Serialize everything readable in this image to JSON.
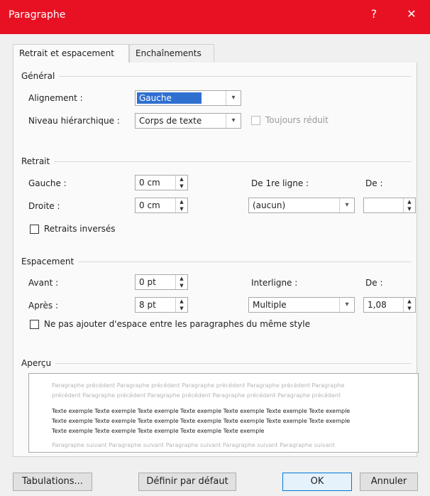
{
  "window": {
    "title": "Paragraphe",
    "help": "?",
    "close": "✕"
  },
  "tabs": [
    {
      "label": "Retrait et espacement"
    },
    {
      "label": "Enchaînements"
    }
  ],
  "general": {
    "heading": "Général",
    "alignment_label": "Alignement :",
    "alignment_value": "Gauche",
    "level_label": "Niveau hiérarchique :",
    "level_value": "Corps de texte",
    "collapsed_label": "Toujours réduit"
  },
  "indent": {
    "heading": "Retrait",
    "left_label": "Gauche :",
    "left_value": "0 cm",
    "right_label": "Droite :",
    "right_value": "0 cm",
    "special_label": "De 1re ligne :",
    "special_value": "(aucun)",
    "by_label": "De :",
    "by_value": "",
    "mirror_label": "Retraits inversés"
  },
  "spacing": {
    "heading": "Espacement",
    "before_label": "Avant :",
    "before_value": "0 pt",
    "after_label": "Après :",
    "after_value": "8 pt",
    "line_label": "Interligne :",
    "line_value": "Multiple",
    "at_label": "De :",
    "at_value": "1,08",
    "dont_add_label": "Ne pas ajouter d'espace entre les paragraphes du même style"
  },
  "preview": {
    "heading": "Aperçu",
    "prev_1": "Paragraphe précédent Paragraphe précédent Paragraphe précédent Paragraphe précédent Paragraphe",
    "prev_2": "précédent Paragraphe précédent Paragraphe précédent Paragraphe précédent Paragraphe précédent",
    "sample_1": "Texte exemple Texte exemple Texte exemple Texte exemple Texte exemple Texte exemple Texte exemple",
    "sample_2": "Texte exemple Texte exemple Texte exemple Texte exemple Texte exemple Texte exemple Texte exemple",
    "sample_3": "Texte exemple Texte exemple Texte exemple Texte exemple Texte exemple",
    "next_1": "Paragraphe suivant Paragraphe suivant Paragraphe suivant Paragraphe suivant Paragraphe suivant"
  },
  "buttons": {
    "tabs": "Tabulations...",
    "default": "Définir par défaut",
    "ok": "OK",
    "cancel": "Annuler"
  },
  "icons": {
    "dropdown": "chevron-down-icon",
    "spinner": "spin-arrows-icon",
    "accent": "#e81123"
  }
}
